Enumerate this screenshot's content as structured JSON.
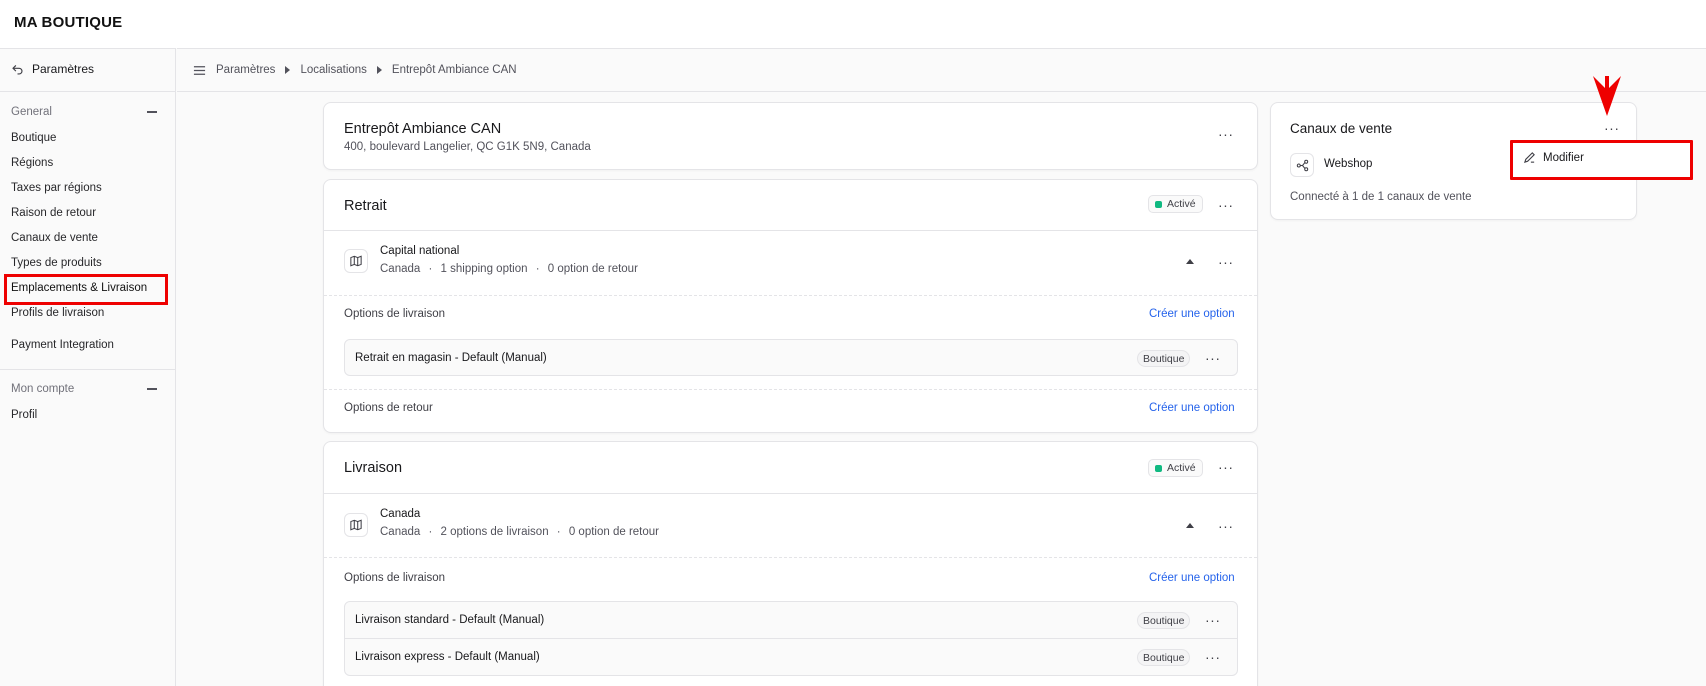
{
  "brand": "MA BOUTIQUE",
  "sidebar": {
    "back_label": "Paramètres",
    "general_section": "General",
    "general_items": [
      "Boutique",
      "Régions",
      "Taxes par régions",
      "Raison de retour",
      "Canaux de vente",
      "Types de produits",
      "Emplacements & Livraison",
      "Profils de livraison"
    ],
    "payment_item": "Payment Integration",
    "account_section": "Mon compte",
    "account_items": [
      "Profil"
    ]
  },
  "breadcrumb": [
    "Paramètres",
    "Localisations",
    "Entrepôt Ambiance CAN"
  ],
  "location": {
    "name": "Entrepôt Ambiance CAN",
    "address": "400, boulevard Langelier, QC G1K 5N9, Canada"
  },
  "pickup": {
    "title": "Retrait",
    "status": "Activé",
    "zone_name": "Capital national",
    "zone_country": "Canada",
    "zone_shipping": "1 shipping option",
    "zone_return": "0 option de retour",
    "shipping_options_label": "Options de livraison",
    "create_option": "Créer une option",
    "options": [
      {
        "name": "Retrait en magasin - Default (Manual)",
        "tag": "Boutique"
      }
    ],
    "return_options_label": "Options de retour",
    "create_return_option": "Créer une option"
  },
  "delivery": {
    "title": "Livraison",
    "status": "Activé",
    "zone_name": "Canada",
    "zone_country": "Canada",
    "zone_shipping": "2 options de livraison",
    "zone_return": "0 option de retour",
    "shipping_options_label": "Options de livraison",
    "create_option": "Créer une option",
    "options": [
      {
        "name": "Livraison standard - Default (Manual)",
        "tag": "Boutique"
      },
      {
        "name": "Livraison express - Default (Manual)",
        "tag": "Boutique"
      }
    ]
  },
  "sales_channels": {
    "title": "Canaux de vente",
    "channel": "Webshop",
    "summary": "Connecté à 1 de 1 canaux de vente"
  },
  "dropdown": {
    "edit_label": "Modifier"
  },
  "colors": {
    "accent_link": "#2563eb",
    "status_green": "#10b981",
    "highlight_red": "#ee0000"
  }
}
